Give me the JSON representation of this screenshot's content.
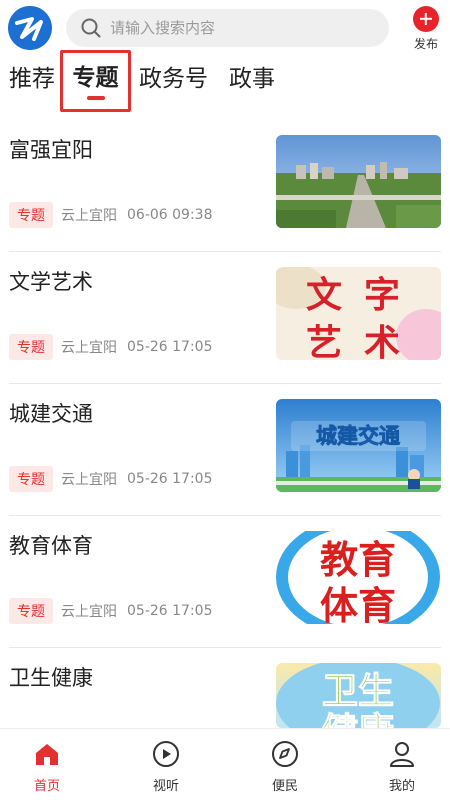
{
  "header": {
    "logo_icon": "app-logo",
    "search_placeholder": "请输入搜索内容",
    "publish_label": "发布"
  },
  "tabs": [
    {
      "label": "推荐",
      "active": false
    },
    {
      "label": "专题",
      "active": true
    },
    {
      "label": "政务号",
      "active": false
    },
    {
      "label": "政事",
      "active": false
    }
  ],
  "articles": [
    {
      "title": "富强宜阳",
      "badge": "专题",
      "source": "云上宜阳",
      "time": "06-06 09:38",
      "thumb": "city-aerial-photo"
    },
    {
      "title": "文学艺术",
      "badge": "专题",
      "source": "云上宜阳",
      "time": "05-26 17:05",
      "thumb": "literature-art-banner"
    },
    {
      "title": "城建交通",
      "badge": "专题",
      "source": "云上宜阳",
      "time": "05-26 17:05",
      "thumb": "urban-traffic-banner"
    },
    {
      "title": "教育体育",
      "badge": "专题",
      "source": "云上宜阳",
      "time": "05-26 17:05",
      "thumb": "education-sports-banner"
    },
    {
      "title": "卫生健康",
      "thumb": "health-banner"
    }
  ],
  "bottom_nav": [
    {
      "label": "首页",
      "icon": "home-icon",
      "active": true
    },
    {
      "label": "视听",
      "icon": "play-icon",
      "active": false
    },
    {
      "label": "便民",
      "icon": "compass-icon",
      "active": false
    },
    {
      "label": "我的",
      "icon": "user-icon",
      "active": false
    }
  ],
  "colors": {
    "accent": "#e2312e",
    "brand": "#1d6fd4"
  },
  "thumb_text": {
    "literature": [
      "文",
      "字",
      "艺",
      "术"
    ],
    "traffic": "城建交通",
    "education": [
      "教育",
      "体育"
    ],
    "health": [
      "卫生",
      "健康"
    ]
  }
}
